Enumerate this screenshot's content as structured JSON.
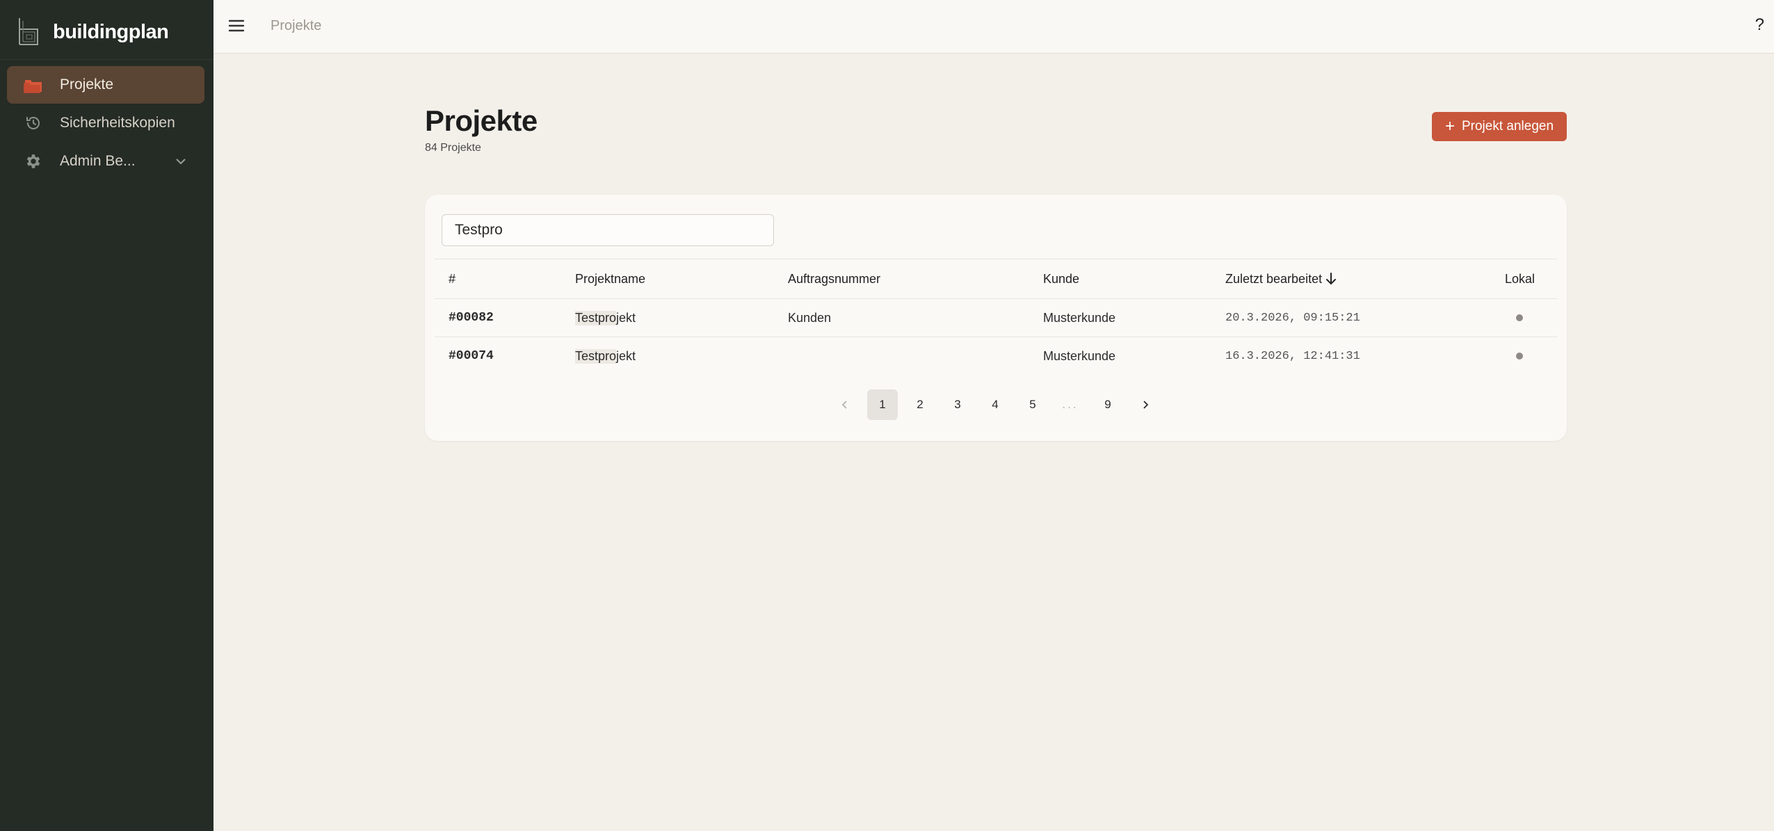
{
  "app": {
    "name": "buildingplan"
  },
  "sidebar": {
    "items": [
      {
        "label": "Projekte",
        "icon": "folder-icon",
        "active": true
      },
      {
        "label": "Sicherheitskopien",
        "icon": "history-icon"
      },
      {
        "label": "Admin Be...",
        "icon": "gear-icon",
        "expandable": true
      }
    ]
  },
  "topbar": {
    "breadcrumb": "Projekte",
    "help": "?"
  },
  "page": {
    "title": "Projekte",
    "count": "84 Projekte",
    "add_button": "Projekt anlegen"
  },
  "search": {
    "value": "Testpro"
  },
  "table": {
    "columns": [
      "#",
      "Projektname",
      "Auftragsnummer",
      "Kunde",
      "Zuletzt bearbeitet",
      "Lokal"
    ],
    "rows": [
      {
        "id": "#00082",
        "name_hl": "Testpro",
        "name_rest": "jekt",
        "auftrag": "Kunden",
        "kunde": "Musterkunde",
        "edited": "20.3.2026, 09:15:21"
      },
      {
        "id": "#00074",
        "name_hl": "Testpro",
        "name_rest": "jekt",
        "auftrag": "",
        "kunde": "Musterkunde",
        "edited": "16.3.2026, 12:41:31"
      }
    ]
  },
  "pagination": {
    "pages": [
      "1",
      "2",
      "3",
      "4",
      "5",
      "...",
      "9"
    ],
    "current": "1"
  },
  "colors": {
    "sidebar_bg": "#252b25",
    "accent": "#c8563a",
    "active_nav": "#5a4434",
    "content_bg": "#f3f0ea"
  }
}
